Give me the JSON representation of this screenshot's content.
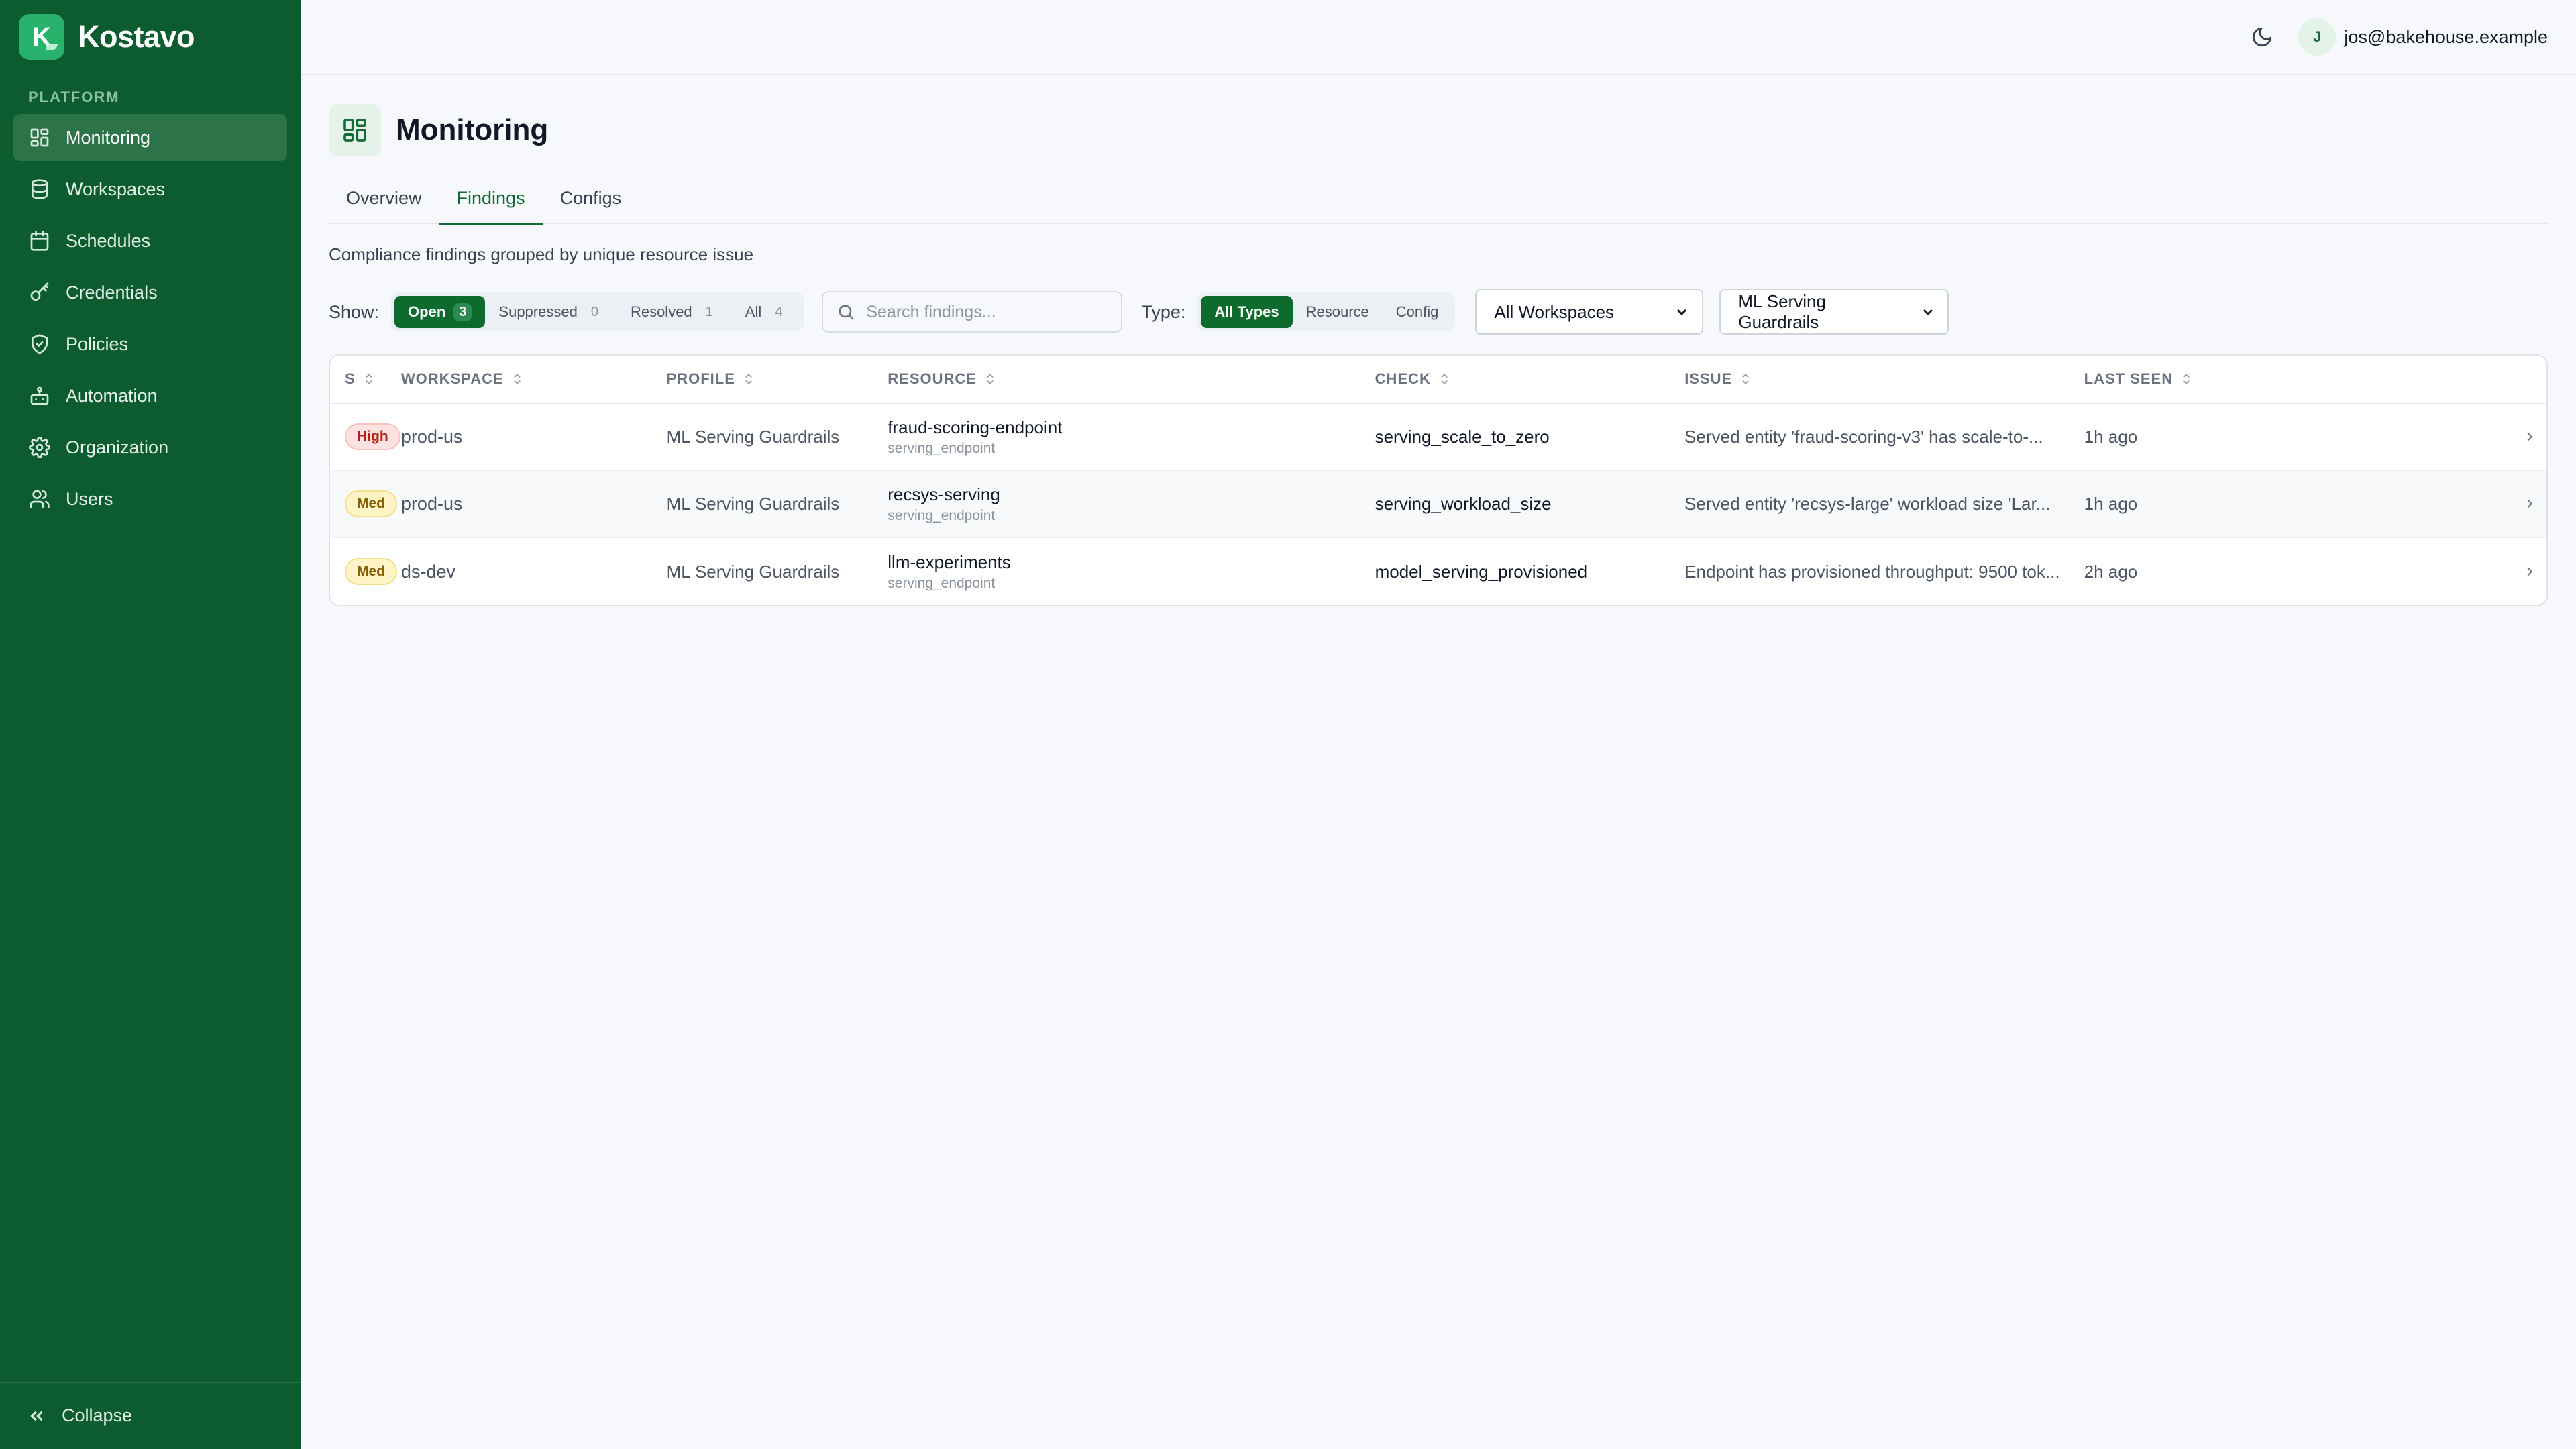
{
  "brand": {
    "letter": "K",
    "name": "Kostavo"
  },
  "sidebar": {
    "section_label": "PLATFORM",
    "items": [
      {
        "label": "Monitoring",
        "icon": "grid-icon",
        "active": true
      },
      {
        "label": "Workspaces",
        "icon": "database-icon"
      },
      {
        "label": "Schedules",
        "icon": "calendar-icon"
      },
      {
        "label": "Credentials",
        "icon": "key-icon"
      },
      {
        "label": "Policies",
        "icon": "shield-icon"
      },
      {
        "label": "Automation",
        "icon": "bot-icon"
      },
      {
        "label": "Organization",
        "icon": "gear-icon"
      },
      {
        "label": "Users",
        "icon": "users-icon"
      }
    ],
    "collapse_label": "Collapse"
  },
  "topbar": {
    "theme_icon": "moon-icon",
    "avatar_initial": "J",
    "user_email": "jos@bakehouse.example"
  },
  "page": {
    "title": "Monitoring",
    "icon": "grid-icon"
  },
  "tabs": [
    {
      "label": "Overview"
    },
    {
      "label": "Findings",
      "active": true
    },
    {
      "label": "Configs"
    }
  ],
  "subtitle": "Compliance findings grouped by unique resource issue",
  "filters": {
    "show_label": "Show:",
    "show": [
      {
        "label": "Open",
        "count": "3",
        "active": true
      },
      {
        "label": "Suppressed",
        "count": "0"
      },
      {
        "label": "Resolved",
        "count": "1"
      },
      {
        "label": "All",
        "count": "4"
      }
    ],
    "search_placeholder": "Search findings...",
    "type_label": "Type:",
    "types": [
      {
        "label": "All Types",
        "active": true
      },
      {
        "label": "Resource"
      },
      {
        "label": "Config"
      }
    ],
    "workspace_select": "All Workspaces",
    "profile_select": "ML Serving Guardrails"
  },
  "table": {
    "columns": [
      "S",
      "WORKSPACE",
      "PROFILE",
      "RESOURCE",
      "CHECK",
      "ISSUE",
      "LAST SEEN"
    ],
    "rows": [
      {
        "severity": "High",
        "severity_level": "high",
        "workspace": "prod-us",
        "profile": "ML Serving Guardrails",
        "resource": "fraud-scoring-endpoint",
        "resource_type": "serving_endpoint",
        "check": "serving_scale_to_zero",
        "issue": "Served entity 'fraud-scoring-v3' has scale-to-...",
        "last_seen": "1h ago"
      },
      {
        "severity": "Med",
        "severity_level": "med",
        "workspace": "prod-us",
        "profile": "ML Serving Guardrails",
        "resource": "recsys-serving",
        "resource_type": "serving_endpoint",
        "check": "serving_workload_size",
        "issue": "Served entity 'recsys-large' workload size 'Lar...",
        "last_seen": "1h ago"
      },
      {
        "severity": "Med",
        "severity_level": "med",
        "workspace": "ds-dev",
        "profile": "ML Serving Guardrails",
        "resource": "llm-experiments",
        "resource_type": "serving_endpoint",
        "check": "model_serving_provisioned",
        "issue": "Endpoint has provisioned throughput: 9500 tok...",
        "last_seen": "2h ago"
      }
    ]
  }
}
